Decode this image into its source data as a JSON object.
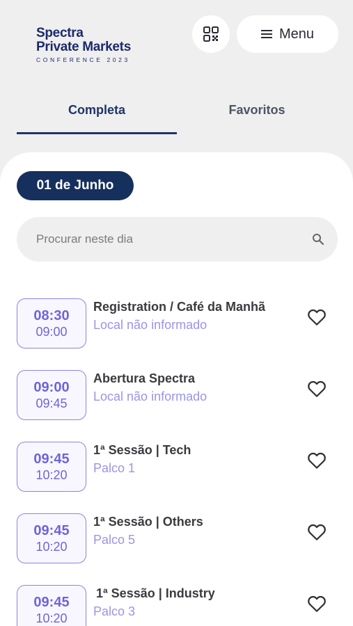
{
  "header": {
    "logo": {
      "line1": "Spectra",
      "line2": "Private Markets",
      "line3": "CONFERENCE 2023"
    },
    "qr_icon": "qr-code-icon",
    "menu": {
      "icon": "hamburger-icon",
      "label": "Menu"
    }
  },
  "tabs": [
    {
      "label": "Completa",
      "active": true
    },
    {
      "label": "Favoritos",
      "active": false
    }
  ],
  "schedule": {
    "date_label": "01 de Junho",
    "search": {
      "placeholder": "Procurar neste dia",
      "value": "",
      "icon": "search-icon"
    },
    "sessions": [
      {
        "start": "08:30",
        "end": "09:00",
        "title": "Registration / Café da Manhã",
        "location": "Local não informado",
        "favorite": false
      },
      {
        "start": "09:00",
        "end": "09:45",
        "title": "Abertura Spectra",
        "location": "Local não informado",
        "favorite": false
      },
      {
        "start": "09:45",
        "end": "10:20",
        "title": "1ª Sessão | Tech",
        "location": "Palco 1",
        "favorite": false
      },
      {
        "start": "09:45",
        "end": "10:20",
        "title": "1ª Sessão | Others",
        "location": "Palco 5",
        "favorite": false
      },
      {
        "start": "09:45",
        "end": "10:20",
        "title": "1ª Sessão | Industry",
        "location": "Palco 3",
        "favorite": false
      }
    ]
  },
  "colors": {
    "brand_navy": "#16305e",
    "accent_purple": "#6d64dc",
    "location_purple": "#9a94ea",
    "background": "#efeff0"
  }
}
